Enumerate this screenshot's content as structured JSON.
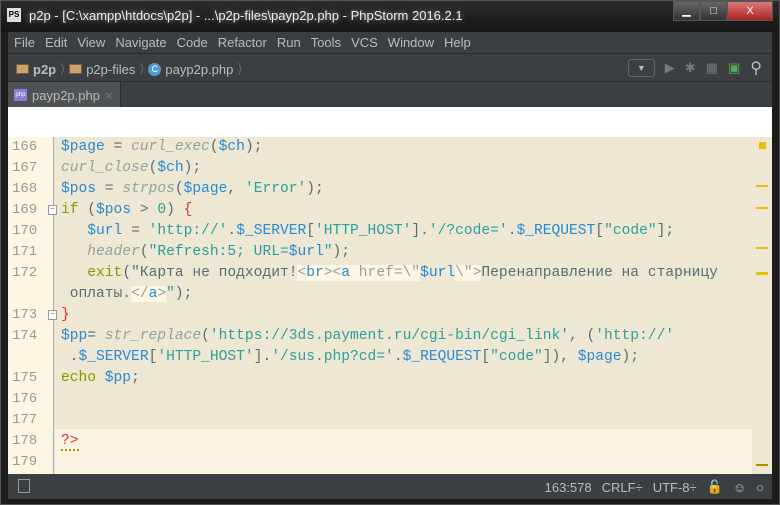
{
  "window": {
    "title": "p2p - [C:\\xampp\\htdocs\\p2p] - ...\\p2p-files\\payp2p.php - PhpStorm 2016.2.1",
    "app_icon": "PS",
    "minimize": "▁",
    "maximize": "□",
    "close": "X"
  },
  "menu": [
    "File",
    "Edit",
    "View",
    "Navigate",
    "Code",
    "Refactor",
    "Run",
    "Tools",
    "VCS",
    "Window",
    "Help"
  ],
  "breadcrumb": {
    "project": "p2p",
    "folder": "p2p-files",
    "file": "payp2p.php",
    "class_icon": "C"
  },
  "toolbar": {
    "dropdown": "▼",
    "run": "▶",
    "debug": "✱",
    "coverage": "▦",
    "profile": "▣",
    "search": "⚲"
  },
  "tab": {
    "label": "payp2p.php",
    "icon": "php",
    "close": "×"
  },
  "code": [
    {
      "n": "166",
      "t": [
        [
          "$page",
          "v"
        ],
        [
          " = ",
          "p"
        ],
        [
          "curl_exec",
          "f"
        ],
        [
          "(",
          "p"
        ],
        [
          "$ch",
          "v"
        ],
        [
          ");",
          "p"
        ]
      ]
    },
    {
      "n": "167",
      "t": [
        [
          "curl_close",
          "f"
        ],
        [
          "(",
          "p"
        ],
        [
          "$ch",
          "v"
        ],
        [
          ");",
          "p"
        ]
      ]
    },
    {
      "n": "168",
      "t": [
        [
          "$pos",
          "v"
        ],
        [
          " = ",
          "p"
        ],
        [
          "strpos",
          "f"
        ],
        [
          "(",
          "p"
        ],
        [
          "$page",
          "v"
        ],
        [
          ", ",
          "p"
        ],
        [
          "'Error'",
          "s"
        ],
        [
          ");",
          "p"
        ]
      ]
    },
    {
      "n": "169",
      "fold": true,
      "t": [
        [
          "if",
          "k"
        ],
        [
          " (",
          "p"
        ],
        [
          "$pos",
          "v"
        ],
        [
          " > ",
          "p"
        ],
        [
          "0",
          "s"
        ],
        [
          ") ",
          "p"
        ],
        [
          "{",
          "b"
        ]
      ]
    },
    {
      "n": "170",
      "t": [
        [
          "   ",
          "p"
        ],
        [
          "$url",
          "v"
        ],
        [
          " = ",
          "p"
        ],
        [
          "'http://'",
          "s"
        ],
        [
          ".",
          "p"
        ],
        [
          "$_SERVER",
          "v"
        ],
        [
          "[",
          "p"
        ],
        [
          "'HTTP_HOST'",
          "s"
        ],
        [
          "].",
          "p"
        ],
        [
          "'/?code='",
          "s"
        ],
        [
          ".",
          "p"
        ],
        [
          "$_REQUEST",
          "v"
        ],
        [
          "[",
          "p"
        ],
        [
          "\"code\"",
          "s"
        ],
        [
          "];",
          "p"
        ]
      ]
    },
    {
      "n": "171",
      "t": [
        [
          "   ",
          "p"
        ],
        [
          "header",
          "f"
        ],
        [
          "(",
          "p"
        ],
        [
          "\"Refresh:5; URL=",
          "s"
        ],
        [
          "$url",
          "v"
        ],
        [
          "\"",
          "s"
        ],
        [
          ");",
          "p"
        ]
      ]
    },
    {
      "n": "172",
      "t": [
        [
          "   ",
          "p"
        ],
        [
          "exit",
          "k"
        ],
        [
          "(",
          "p"
        ],
        [
          "\"Карта не подходит!",
          "p"
        ],
        [
          "<",
          "hp"
        ],
        [
          "br",
          "h"
        ],
        [
          "><",
          "hp"
        ],
        [
          "a",
          "h"
        ],
        [
          " href=\\\"",
          "hp"
        ],
        [
          "$url",
          "v"
        ],
        [
          "\\\">",
          "hp"
        ],
        [
          "Перенаправление на старницу",
          "p"
        ]
      ]
    },
    {
      "n": "",
      "t": [
        [
          " оплаты.",
          "p"
        ],
        [
          "</",
          "hp"
        ],
        [
          "a",
          "h"
        ],
        [
          ">",
          "hp"
        ],
        [
          "\"",
          "s"
        ],
        [
          ");",
          "p"
        ]
      ]
    },
    {
      "n": "173",
      "fold": true,
      "t": [
        [
          "}",
          "b"
        ]
      ]
    },
    {
      "n": "174",
      "t": [
        [
          "$pp",
          "v"
        ],
        [
          "= ",
          "p"
        ],
        [
          "str_replace",
          "f"
        ],
        [
          "(",
          "p"
        ],
        [
          "'https://3ds.payment.ru/cgi-bin/cgi_link'",
          "s"
        ],
        [
          ", (",
          "p"
        ],
        [
          "'http://'",
          "s"
        ]
      ]
    },
    {
      "n": "",
      "t": [
        [
          " .",
          "p"
        ],
        [
          "$_SERVER",
          "v"
        ],
        [
          "[",
          "p"
        ],
        [
          "'HTTP_HOST'",
          "s"
        ],
        [
          "].",
          "p"
        ],
        [
          "'/sus.php?cd='",
          "s"
        ],
        [
          ".",
          "p"
        ],
        [
          "$_REQUEST",
          "v"
        ],
        [
          "[",
          "p"
        ],
        [
          "\"code\"",
          "s"
        ],
        [
          "]), ",
          "p"
        ],
        [
          "$page",
          "v"
        ],
        [
          ");",
          "p"
        ]
      ]
    },
    {
      "n": "175",
      "t": [
        [
          "echo",
          "k"
        ],
        [
          " ",
          "p"
        ],
        [
          "$pp",
          "v"
        ],
        [
          ";",
          "p"
        ]
      ]
    },
    {
      "n": "176",
      "t": []
    },
    {
      "n": "177",
      "t": []
    },
    {
      "n": "178",
      "t": [
        [
          "?>",
          "q"
        ]
      ]
    },
    {
      "n": "179",
      "t": []
    }
  ],
  "status": {
    "position": "163:578",
    "line_sep": "CRLF÷",
    "encoding": "UTF-8÷",
    "lock": "🔓",
    "inspector": "☺",
    "search": "○"
  }
}
